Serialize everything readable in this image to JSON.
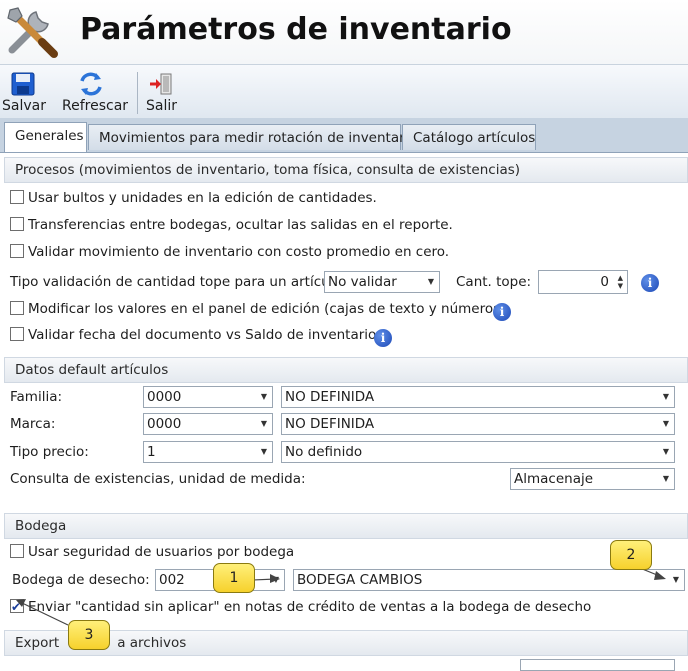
{
  "window": {
    "title": "Parámetros de inventario",
    "icon": "tools-icon"
  },
  "toolbar": {
    "save_label": "Salvar",
    "refresh_label": "Refrescar",
    "exit_label": "Salir"
  },
  "tabs": [
    {
      "label": "Generales",
      "active": true
    },
    {
      "label": "Movimientos para medir rotación de inventario",
      "active": false
    },
    {
      "label": "Catálogo artículos",
      "active": false
    }
  ],
  "procesos": {
    "header": "Procesos (movimientos de inventario, toma física, consulta de existencias)",
    "chk_bultos": "Usar bultos y unidades en la edición de cantidades.",
    "chk_transferencias": "Transferencias entre bodegas, ocultar las salidas en el reporte.",
    "chk_costo_cero": "Validar movimiento de inventario con costo promedio en cero.",
    "tipo_validacion_label": "Tipo validación de cantidad tope para un artículo:",
    "tipo_validacion_value": "No validar",
    "cant_tope_label": "Cant. tope:",
    "cant_tope_value": "0",
    "chk_modificar": "Modificar los valores en el panel de edición (cajas de texto y números).",
    "chk_validar_fecha": "Validar fecha del documento vs Saldo de inventarios."
  },
  "datos_default": {
    "header": "Datos default artículos",
    "familia_label": "Familia:",
    "familia_code": "0000",
    "familia_desc": "NO DEFINIDA",
    "marca_label": "Marca:",
    "marca_code": "0000",
    "marca_desc": "NO DEFINIDA",
    "tipo_precio_label": "Tipo precio:",
    "tipo_precio_code": "1",
    "tipo_precio_desc": "No definido",
    "consulta_label": "Consulta de existencias, unidad de medida:",
    "consulta_value": "Almacenaje"
  },
  "bodega": {
    "header": "Bodega",
    "chk_seguridad": "Usar seguridad de usuarios por bodega",
    "desecho_label": "Bodega de desecho:",
    "desecho_code": "002",
    "desecho_desc": "BODEGA CAMBIOS",
    "chk_enviar": "Enviar \"cantidad sin aplicar\" en notas de crédito de ventas a la bodega de desecho"
  },
  "exportar": {
    "header_part1": "Export",
    "header_part2": "a archivos"
  },
  "callouts": [
    "1",
    "2",
    "3"
  ],
  "colors": {
    "accent": "#1c48b6",
    "callout": "#f6d12c",
    "tab_strip": "#c6d3e1"
  }
}
